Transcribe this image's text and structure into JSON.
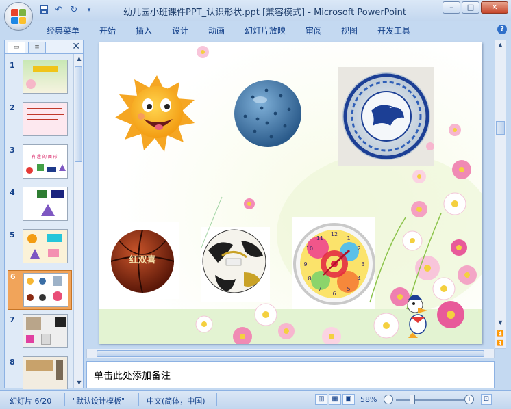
{
  "window": {
    "title": "幼儿园小班课件PPT_认识形状.ppt [兼容模式] - Microsoft PowerPoint",
    "minimize": "–",
    "maximize": "□",
    "close": "✕"
  },
  "ribbon": {
    "tabs": [
      "经典菜单",
      "开始",
      "插入",
      "设计",
      "动画",
      "幻灯片放映",
      "审阅",
      "视图",
      "开发工具"
    ]
  },
  "thumbnails": {
    "numbers": [
      "1",
      "2",
      "3",
      "4",
      "5",
      "6",
      "7",
      "8"
    ],
    "active_index": 6,
    "slide3_title": "有 趣 的 图 形"
  },
  "slide": {
    "images": [
      "sun",
      "spiky-ball",
      "blue-white-plate",
      "basketball",
      "soccer-ball",
      "clock",
      "donald-duck",
      "cosmos-flowers"
    ],
    "basketball_brand": "红双喜",
    "clock_numbers": [
      "12",
      "1",
      "2",
      "3",
      "4",
      "5",
      "6",
      "7",
      "8",
      "9",
      "10",
      "11"
    ]
  },
  "notes": {
    "placeholder": "单击此处添加备注"
  },
  "status": {
    "slide_info": "幻灯片 6/20",
    "theme": "\"默认设计模板\"",
    "language": "中文(简体，中国)",
    "zoom": "58%",
    "zoom_fraction": 0.35
  },
  "colors": {
    "ribbon_bg": "#c4d9f1",
    "accent": "#15428b",
    "active_thumb": "#f1a45a"
  }
}
